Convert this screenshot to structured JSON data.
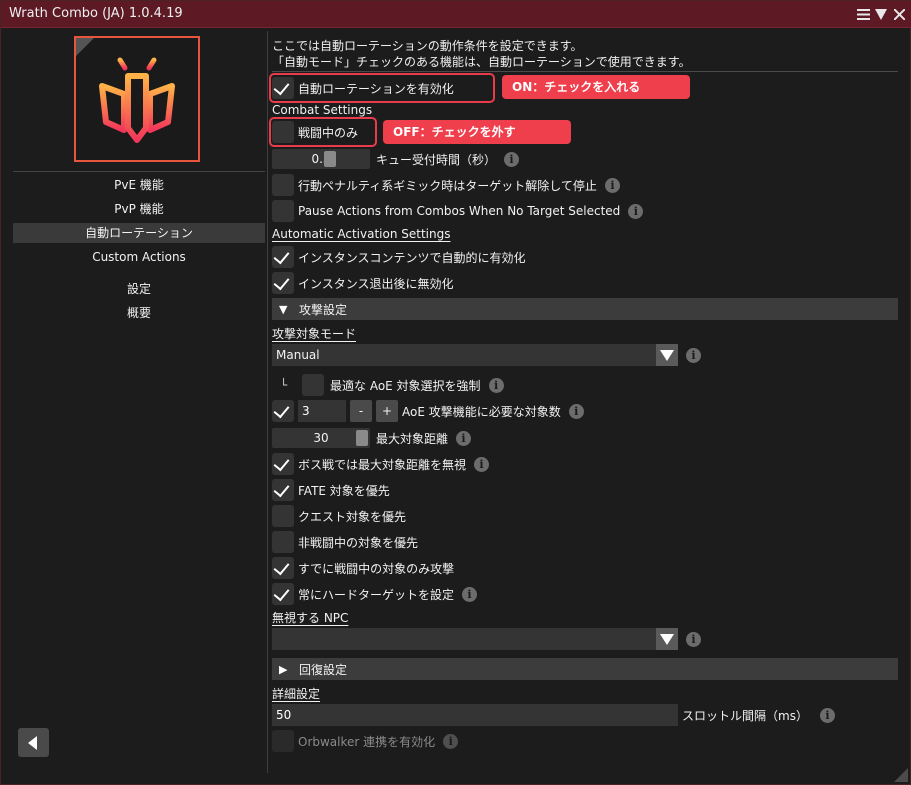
{
  "window": {
    "title": "Wrath Combo (JA) 1.0.4.19",
    "menu_icon": "hamburger-icon",
    "collapse_icon": "triangle-down-icon",
    "close_icon": "close-icon"
  },
  "sidebar": {
    "logo_icon": "wrath-combo-logo",
    "items": [
      {
        "label": "PvE 機能"
      },
      {
        "label": "PvP 機能"
      },
      {
        "label": "自動ローテーション"
      },
      {
        "label": "Custom Actions"
      },
      {
        "label": "設定"
      },
      {
        "label": "概要"
      }
    ],
    "active_index": 2,
    "back_icon": "back-arrow-icon"
  },
  "content": {
    "description_line1": "ここでは自動ローテーションの動作条件を設定できます。",
    "description_line2": "「自動モード」チェックのある機能は、自動ローテーションで使用できます。",
    "enable_auto_rotation": {
      "label": "自動ローテーションを有効化",
      "checked": true
    },
    "note_on": "ON：チェックを入れる",
    "combat_settings_heading": "Combat Settings",
    "combat_only": {
      "label": "戦闘中のみ",
      "checked": false
    },
    "note_off": "OFF：チェックを外す",
    "queue_window": {
      "value": "0.3",
      "label": "キュー受付時間（秒）",
      "fraction": 0.3
    },
    "penalty_stop": {
      "label": "行動ペナルティ系ギミック時はターゲット解除して停止",
      "checked": false
    },
    "pause_no_target": {
      "label": "Pause Actions from Combos When No Target Selected",
      "checked": false
    },
    "auto_activation_heading": "Automatic Activation Settings",
    "auto_enable_instance": {
      "label": "インスタンスコンテンツで自動的に有効化",
      "checked": true
    },
    "disable_after_exit": {
      "label": "インスタンス退出後に無効化",
      "checked": true
    },
    "attack_section": "攻撃設定",
    "target_mode_heading": "攻撃対象モード",
    "target_mode_value": "Manual",
    "tree_branch": "└",
    "force_best_aoe": {
      "label": "最適な AoE 対象選択を強制",
      "checked": false
    },
    "aoe_required": {
      "checked": true,
      "value": "3",
      "minus": "-",
      "plus": "+",
      "label": "AoE 攻撃機能に必要な対象数"
    },
    "max_distance": {
      "value": "30",
      "label": "最大対象距離",
      "fraction": 1.0
    },
    "ignore_max_distance_boss": {
      "label": "ボス戦では最大対象距離を無視",
      "checked": true
    },
    "prioritize_fate": {
      "label": "FATE 対象を優先",
      "checked": true
    },
    "prioritize_quest": {
      "label": "クエスト対象を優先",
      "checked": false
    },
    "prioritize_noncombat": {
      "label": "非戦闘中の対象を優先",
      "checked": false
    },
    "only_in_combat_targets": {
      "label": "すでに戦闘中の対象のみ攻撃",
      "checked": true
    },
    "always_hard_target": {
      "label": "常にハードターゲットを設定",
      "checked": true
    },
    "ignore_npc_heading": "無視する NPC",
    "ignore_npc_value": "",
    "heal_section": "回復設定",
    "advanced_heading": "詳細設定",
    "throttle": {
      "value": "50",
      "label": "スロットル間隔（ms）"
    },
    "orbwalker": {
      "label": "Orbwalker 連携を有効化",
      "checked": false
    },
    "info_glyph": "i"
  },
  "colors": {
    "titlebar": "#5d1a25",
    "highlight": "#e83c4a",
    "note_bg": "#f03f4c",
    "logo_accent": "#e7553f"
  }
}
